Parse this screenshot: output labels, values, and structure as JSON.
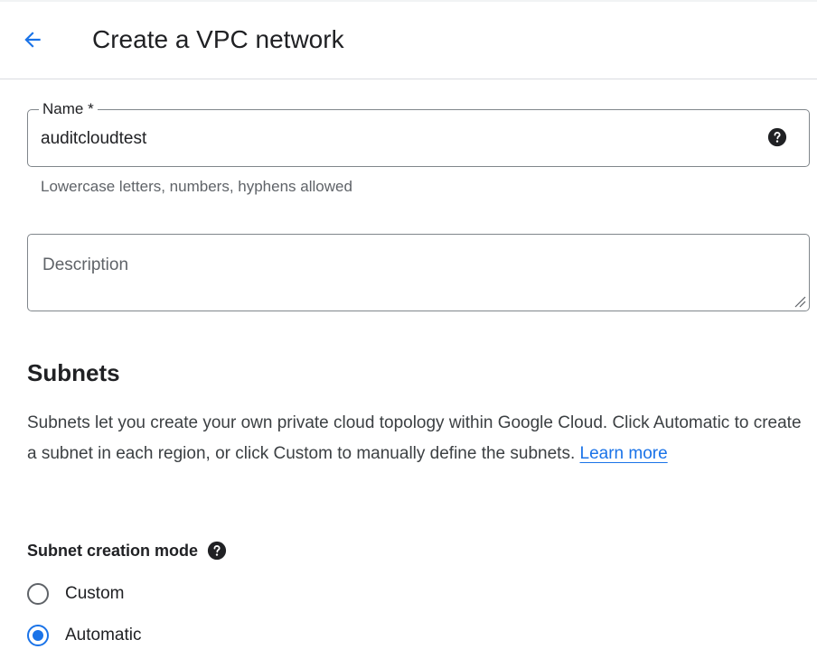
{
  "header": {
    "title": "Create a VPC network",
    "back_icon": "arrow-back-icon",
    "accent_color": "#1a73e8"
  },
  "form": {
    "name": {
      "label": "Name *",
      "value": "auditcloudtest",
      "help_icon": "help-circle-icon",
      "hint": "Lowercase letters, numbers, hyphens allowed"
    },
    "description": {
      "placeholder": "Description",
      "value": ""
    }
  },
  "subnets": {
    "title": "Subnets",
    "body_text": "Subnets let you create your own private cloud topology within Google Cloud. Click Automatic to create a subnet in each region, or click Custom to manually define the subnets.",
    "learn_more": "Learn more",
    "mode_label": "Subnet creation mode",
    "options": [
      {
        "label": "Custom",
        "selected": false
      },
      {
        "label": "Automatic",
        "selected": true
      }
    ]
  }
}
